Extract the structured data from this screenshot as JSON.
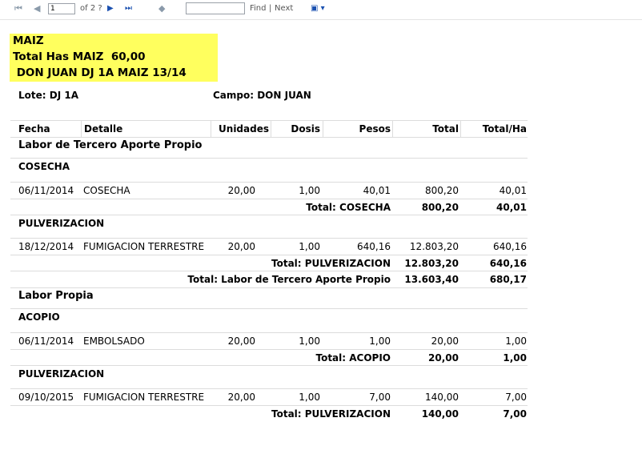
{
  "toolbar": {
    "first_icon": "⏮",
    "prev_icon": "◀",
    "page_value": "1",
    "page_of": "of 2 ?",
    "next_icon": "▶",
    "last_icon": "⏭",
    "back_icon": "◆",
    "find_value": "",
    "find_label": "Find",
    "separator": "|",
    "next_label": "Next",
    "export_icon": "▣ ▾"
  },
  "report": {
    "header": {
      "crop": "MAIZ",
      "total_has": "Total Has MAIZ  60,00",
      "lot_line": " DON JUAN DJ 1A MAIZ 13/14"
    },
    "lote": "Lote: DJ 1A",
    "campo": "Campo: DON JUAN",
    "columns": [
      "Fecha",
      "Detalle",
      "Unidades",
      "Dosis",
      "Pesos",
      "Total",
      "Total/Ha"
    ],
    "sections": [
      {
        "title": "Labor de Tercero Aporte Propio",
        "groups": [
          {
            "title": "COSECHA",
            "rows": [
              {
                "fecha": "06/11/2014",
                "detalle": "COSECHA",
                "unidades": "20,00",
                "dosis": "1,00",
                "pesos": "40,01",
                "total": "800,20",
                "total_ha": "40,01"
              }
            ],
            "subtotal": {
              "label": "Total: COSECHA",
              "total": "800,20",
              "total_ha": "40,01"
            }
          },
          {
            "title": "PULVERIZACION",
            "rows": [
              {
                "fecha": "18/12/2014",
                "detalle": "FUMIGACION TERRESTRE",
                "unidades": "20,00",
                "dosis": "1,00",
                "pesos": "640,16",
                "total": "12.803,20",
                "total_ha": "640,16"
              }
            ],
            "subtotal": {
              "label": "Total: PULVERIZACION",
              "total": "12.803,20",
              "total_ha": "640,16"
            }
          }
        ],
        "total": {
          "label": "Total: Labor de Tercero Aporte Propio",
          "total": "13.603,40",
          "total_ha": "680,17"
        }
      },
      {
        "title": "Labor Propia",
        "groups": [
          {
            "title": "ACOPIO",
            "rows": [
              {
                "fecha": "06/11/2014",
                "detalle": "EMBOLSADO",
                "unidades": "20,00",
                "dosis": "1,00",
                "pesos": "1,00",
                "total": "20,00",
                "total_ha": "1,00"
              }
            ],
            "subtotal": {
              "label": "Total: ACOPIO",
              "total": "20,00",
              "total_ha": "1,00"
            }
          },
          {
            "title": "PULVERIZACION",
            "rows": [
              {
                "fecha": "09/10/2015",
                "detalle": "FUMIGACION TERRESTRE",
                "unidades": "20,00",
                "dosis": "1,00",
                "pesos": "7,00",
                "total": "140,00",
                "total_ha": "7,00"
              }
            ],
            "subtotal": {
              "label": "Total: PULVERIZACION",
              "total": "140,00",
              "total_ha": "7,00"
            }
          }
        ]
      }
    ]
  }
}
